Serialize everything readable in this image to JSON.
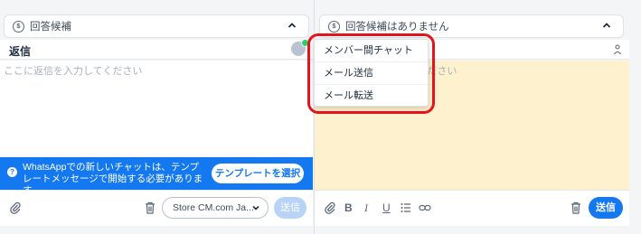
{
  "left_panel": {
    "suggestion": {
      "label": "回答候補",
      "icon": "dollar-circle-icon"
    },
    "reply_title": "返信",
    "placeholder": "ここに返信を入力してください",
    "banner": {
      "message": "WhatsAppでの新しいチャットは、テンプレートメッセージで開始する必要があります",
      "button": "テンプレートを選択"
    },
    "channel_select": "Store CM.com Ja...",
    "send_label": "送信"
  },
  "right_panel": {
    "suggestion": {
      "label": "回答候補はありません",
      "icon": "dollar-circle-icon"
    },
    "placeholder": "ここに返信を入力してください",
    "send_label": "送信"
  },
  "menu": {
    "items": [
      "メンバー間チャット",
      "メール送信",
      "メール転送"
    ]
  },
  "colors": {
    "accent": "#1478f0",
    "note_background": "#fdf2cd",
    "highlight": "#e3141b",
    "whatsapp": "#25d366"
  }
}
